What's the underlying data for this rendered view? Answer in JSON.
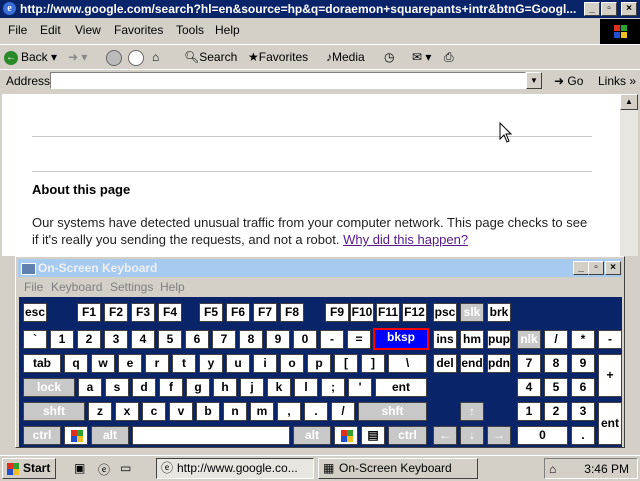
{
  "browser": {
    "title": "http://www.google.com/search?hl=en&source=hp&q=doraemon+squarepants+intr&btnG=Googl...",
    "menu": [
      "File",
      "Edit",
      "View",
      "Favorites",
      "Tools",
      "Help"
    ],
    "toolbar": {
      "back": "Back",
      "search": "Search",
      "favorites": "Favorites",
      "media": "Media"
    },
    "address_label": "Address",
    "address_value": "",
    "go_label": "Go",
    "links_label": "Links"
  },
  "page": {
    "heading": "About this page",
    "paragraph": "Our systems have detected unusual traffic from your computer network. This page checks to see if it's really you sending the requests, and not a robot.",
    "link": "Why did this happen?"
  },
  "osk": {
    "title": "On-Screen Keyboard",
    "menu": [
      "File",
      "Keyboard",
      "Settings",
      "Help"
    ],
    "keys": {
      "esc": "esc",
      "f1": "F1",
      "f2": "F2",
      "f3": "F3",
      "f4": "F4",
      "f5": "F5",
      "f6": "F6",
      "f7": "F7",
      "f8": "F8",
      "f9": "F9",
      "f10": "F10",
      "f11": "F11",
      "f12": "F12",
      "psc": "psc",
      "slk": "slk",
      "brk": "brk",
      "backtick": "`",
      "n1": "1",
      "n2": "2",
      "n3": "3",
      "n4": "4",
      "n5": "5",
      "n6": "6",
      "n7": "7",
      "n8": "8",
      "n9": "9",
      "n0": "0",
      "minus": "-",
      "equals": "=",
      "bksp": "bksp",
      "ins": "ins",
      "hm": "hm",
      "pup": "pup",
      "nlk": "nlk",
      "np_div": "/",
      "np_mul": "*",
      "np_sub": "-",
      "tab": "tab",
      "q": "q",
      "w": "w",
      "e": "e",
      "r": "r",
      "t": "t",
      "y": "y",
      "u": "u",
      "i": "i",
      "o": "o",
      "p": "p",
      "lbr": "[",
      "rbr": "]",
      "bslash": "\\",
      "del": "del",
      "end": "end",
      "pdn": "pdn",
      "np7": "7",
      "np8": "8",
      "np9": "9",
      "np_add": "+",
      "lock": "lock",
      "a": "a",
      "s": "s",
      "d": "d",
      "f": "f",
      "g": "g",
      "h": "h",
      "j": "j",
      "k": "k",
      "l": "l",
      "semi": ";",
      "quote": "'",
      "ent": "ent",
      "np4": "4",
      "np5": "5",
      "np6": "6",
      "shft": "shft",
      "z": "z",
      "x": "x",
      "c": "c",
      "v": "v",
      "b": "b",
      "n": "n",
      "m": "m",
      "comma": ",",
      "period": ".",
      "slash": "/",
      "shft_r": "shft",
      "up": "↑",
      "np1": "1",
      "np2": "2",
      "np3": "3",
      "np_ent": "ent",
      "ctrl": "ctrl",
      "alt": "alt",
      "alt_r": "alt",
      "ctrl_r": "ctrl",
      "left": "←",
      "down": "↓",
      "right": "→",
      "np0": "0",
      "np_dot": "."
    }
  },
  "taskbar": {
    "start": "Start",
    "tasks": [
      "http://www.google.co...",
      "On-Screen Keyboard"
    ],
    "clock": "3:46 PM"
  },
  "colors": {
    "titlebar_active": "#0a246a",
    "titlebar_inactive": "#a6caf0",
    "keyboard_bg": "#0a246a",
    "highlight_key": "#0000ff",
    "link": "#551a8b"
  }
}
